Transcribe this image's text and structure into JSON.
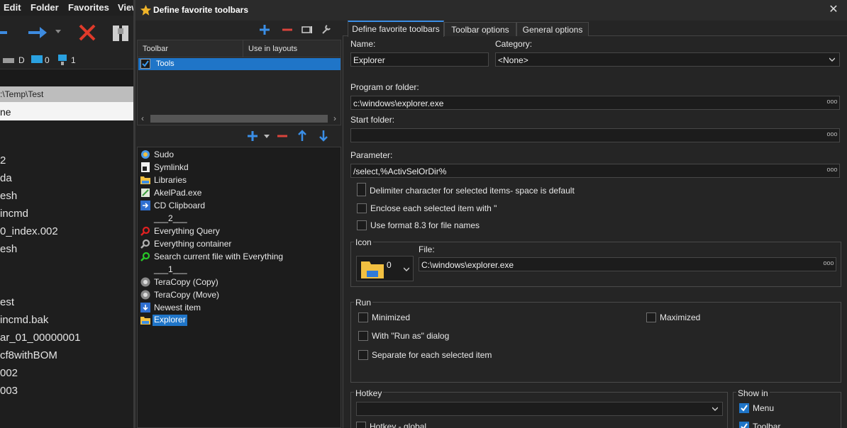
{
  "background_window": {
    "menu": [
      "Edit",
      "Folder",
      "Favorites",
      "View"
    ],
    "drives": [
      {
        "label": "D"
      },
      {
        "label": "0"
      },
      {
        "label": "1"
      }
    ],
    "path": ":\\Temp\\Test",
    "column_header": "ne",
    "files": [
      "2",
      "da",
      "esh",
      "incmd",
      "0_index.002",
      "esh",
      "",
      "",
      "est",
      "incmd.bak",
      "ar_01_00000001",
      "cf8withBOM",
      "002",
      "003"
    ]
  },
  "dialog": {
    "title": "Define favorite toolbars",
    "toolbar_table": {
      "columns": [
        "Toolbar",
        "Use in layouts"
      ],
      "rows": [
        {
          "name": "Tools",
          "checked": true
        }
      ]
    },
    "items": [
      {
        "label": "Sudo",
        "icon": "sudo-icon"
      },
      {
        "label": "Symlinkd",
        "icon": "symlink-icon"
      },
      {
        "label": "Libraries",
        "icon": "folder-icon"
      },
      {
        "label": "AkelPad.exe",
        "icon": "akelpad-icon"
      },
      {
        "label": "CD Clipboard",
        "icon": "cd-clipboard-icon"
      },
      {
        "label": "___2___",
        "icon": ""
      },
      {
        "label": "Everything Query",
        "icon": "red-search-icon"
      },
      {
        "label": "Everything container",
        "icon": "grey-search-icon"
      },
      {
        "label": "Search current file with Everything",
        "icon": "green-search-icon"
      },
      {
        "label": "___1___",
        "icon": ""
      },
      {
        "label": "TeraCopy (Copy)",
        "icon": "teracopy-icon"
      },
      {
        "label": "TeraCopy (Move)",
        "icon": "teracopy-icon"
      },
      {
        "label": "Newest item",
        "icon": "newest-item-icon"
      },
      {
        "label": "Explorer",
        "icon": "folder-icon",
        "selected": true
      }
    ],
    "tabs": [
      "Define favorite toolbars",
      "Toolbar options",
      "General options"
    ],
    "form": {
      "name_label": "Name:",
      "name_value": "Explorer",
      "category_label": "Category:",
      "category_value": "<None>",
      "program_label": "Program or folder:",
      "program_value": "c:\\windows\\explorer.exe",
      "start_folder_label": "Start folder:",
      "start_folder_value": "",
      "parameter_label": "Parameter:",
      "parameter_value": "/select,%ActivSelOrDir%",
      "delimiter_label": "Delimiter character for selected items- space is default",
      "enclose_label": "Enclose each selected item with \"",
      "format83_label": "Use format 8.3 for file names",
      "icon_group": "Icon",
      "icon_index": "0",
      "file_label": "File:",
      "file_value": "C:\\windows\\explorer.exe",
      "run_group": "Run",
      "minimized_label": "Minimized",
      "maximized_label": "Maximized",
      "runas_label": "With \"Run as\" dialog",
      "separate_label": "Separate for each selected item",
      "hotkey_group": "Hotkey",
      "hotkey_value": "",
      "hotkey_global_label": "Hotkey - global",
      "showin_group": "Show in",
      "menu_label": "Menu",
      "menu_checked": true,
      "toolbar_label": "Toolbar",
      "toolbar_checked": true
    }
  },
  "colors": {
    "accent": "#1f75c8",
    "remove": "#d9443c",
    "add": "#3a8ee6"
  }
}
